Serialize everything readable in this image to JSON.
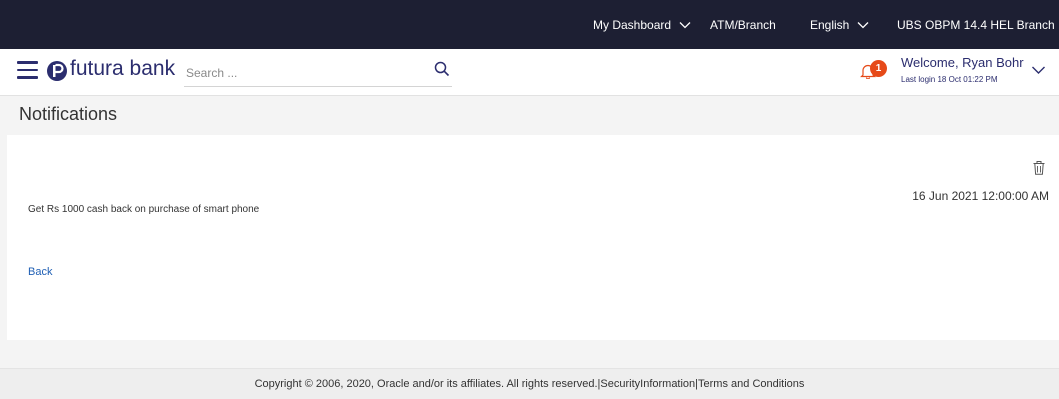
{
  "topbar": {
    "dashboard": "My Dashboard",
    "atm_branch": "ATM/Branch",
    "language": "English",
    "branch": "UBS OBPM 14.4 HEL Branch"
  },
  "header": {
    "brand": "futura bank",
    "search_placeholder": "Search ...",
    "notification_count": "1",
    "welcome": "Welcome, Ryan Bohr",
    "last_login": "Last login 18 Oct 01:22 PM"
  },
  "page": {
    "title": "Notifications"
  },
  "notification": {
    "message": "Get Rs 1000 cash back on purchase of smart  phone",
    "date": "16 Jun 2021 12:00:00 AM",
    "back_label": "Back"
  },
  "footer": {
    "copyright": "Copyright © 2006, 2020, Oracle and/or its affiliates. All rights reserved.",
    "sep1": "|",
    "security": "SecurityInformation",
    "sep2": "|",
    "terms": "Terms and Conditions"
  },
  "colors": {
    "topbar_bg": "#1d1f33",
    "brand": "#2b2d6e",
    "badge": "#e64a19",
    "link": "#1f5fb4"
  }
}
